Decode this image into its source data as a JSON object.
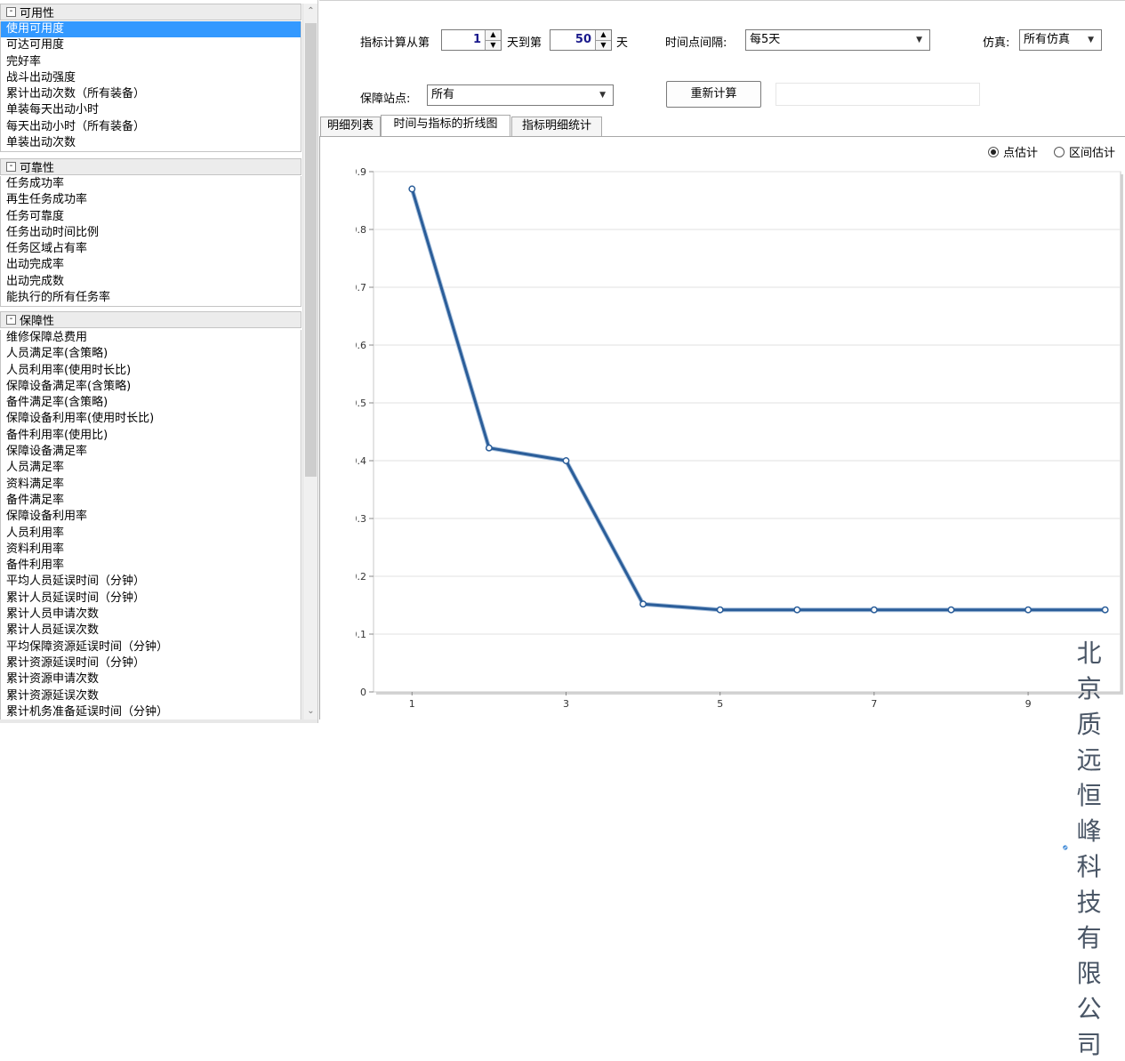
{
  "left_panel": {
    "groups": [
      {
        "title": "可用性",
        "items": [
          "使用可用度",
          "可达可用度",
          "完好率",
          "战斗出动强度",
          "累计出动次数（所有装备）",
          "单装每天出动小时",
          "每天出动小时（所有装备）",
          "单装出动次数"
        ]
      },
      {
        "title": "可靠性",
        "items": [
          "任务成功率",
          "再生任务成功率",
          "任务可靠度",
          "任务出动时间比例",
          "任务区域占有率",
          "出动完成率",
          "出动完成数",
          "能执行的所有任务率"
        ]
      },
      {
        "title": "保障性",
        "items": [
          "维修保障总费用",
          "人员满足率(含策略)",
          "人员利用率(使用时长比)",
          "保障设备满足率(含策略)",
          "备件满足率(含策略)",
          "保障设备利用率(使用时长比)",
          "备件利用率(使用比)",
          "保障设备满足率",
          "人员满足率",
          "资料满足率",
          "备件满足率",
          "保障设备利用率",
          "人员利用率",
          "资料利用率",
          "备件利用率",
          "平均人员延误时间（分钟）",
          "累计人员延误时间（分钟）",
          "累计人员申请次数",
          "累计人员延误次数",
          "平均保障资源延误时间（分钟）",
          "累计资源延误时间（分钟）",
          "累计资源申请次数",
          "累计资源延误次数",
          "累计机务准备延误时间（分钟）"
        ]
      }
    ],
    "selected": "使用可用度",
    "collapse_glyph": "-"
  },
  "controls": {
    "range_prefix": "指标计算从第",
    "start_day": "1",
    "range_middle": "天到第",
    "end_day": "50",
    "range_suffix": "天",
    "interval_label": "时间点间隔:",
    "interval_value": "每5天",
    "sim_label": "仿真:",
    "sim_value": "所有仿真",
    "station_label": "保障站点:",
    "station_value": "所有",
    "recalc_label": "重新计算"
  },
  "tabs": [
    "明细列表",
    "时间与指标的折线图",
    "指标明细统计"
  ],
  "active_tab": "时间与指标的折线图",
  "estimate_options": {
    "point": "点估计",
    "interval": "区间估计",
    "selected": "point"
  },
  "chart_data": {
    "type": "line",
    "x": [
      1,
      2,
      3,
      4,
      5,
      6,
      7,
      8,
      9,
      10
    ],
    "x_tick_labels": [
      "1",
      "3",
      "5",
      "7",
      "9"
    ],
    "y_tick_labels": [
      "0",
      "0.1",
      "0.2",
      "0.3",
      "0.4",
      "0.5",
      "0.6",
      "0.7",
      "0.8",
      "0.9"
    ],
    "series": [
      {
        "values": [
          0.87,
          0.422,
          0.4,
          0.152,
          0.142,
          0.142,
          0.142,
          0.142,
          0.142,
          0.142
        ],
        "color": "#2a5d99"
      }
    ],
    "xlim": [
      0.5,
      10.2
    ],
    "ylim": [
      0,
      0.9
    ],
    "grid": "horizontal"
  },
  "watermark": {
    "text": "北京质远恒峰科技有限公司",
    "color": "#3a86d6"
  },
  "colors": {
    "selection": "#3399ff",
    "line": "#2a5d99",
    "spin_value": "#1a1a8c"
  }
}
